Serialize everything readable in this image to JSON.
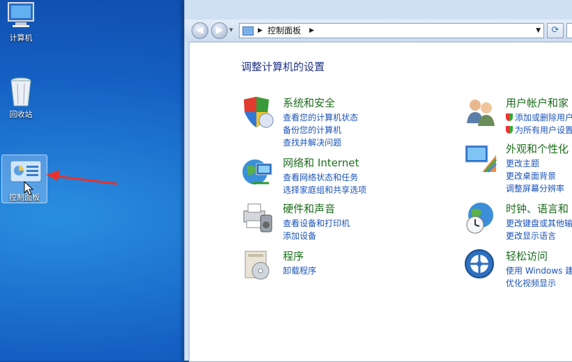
{
  "desktop": {
    "icons": [
      {
        "label": "计算机"
      },
      {
        "label": "回收站"
      },
      {
        "label": "控制面板"
      }
    ]
  },
  "address": {
    "crumb": "控制面板"
  },
  "page": {
    "title": "调整计算机的设置"
  },
  "categories": [
    {
      "title": "系统和安全",
      "links": [
        "查看您的计算机状态",
        "备份您的计算机",
        "查找并解决问题"
      ]
    },
    {
      "title": "网络和 Internet",
      "links": [
        "查看网络状态和任务",
        "选择家庭组和共享选项"
      ]
    },
    {
      "title": "硬件和声音",
      "links": [
        "查看设备和打印机",
        "添加设备"
      ]
    },
    {
      "title": "程序",
      "links": [
        "卸载程序"
      ]
    },
    {
      "title": "用户帐户和家",
      "links": [
        "添加或删除用户",
        "为所有用户设置"
      ]
    },
    {
      "title": "外观和个性化",
      "links": [
        "更改主题",
        "更改桌面背景",
        "调整屏幕分辨率"
      ]
    },
    {
      "title": "时钟、语言和",
      "links": [
        "更改键盘或其他输",
        "更改显示语言"
      ]
    },
    {
      "title": "轻松访问",
      "links": [
        "使用 Windows 建",
        "优化视频显示"
      ]
    }
  ]
}
